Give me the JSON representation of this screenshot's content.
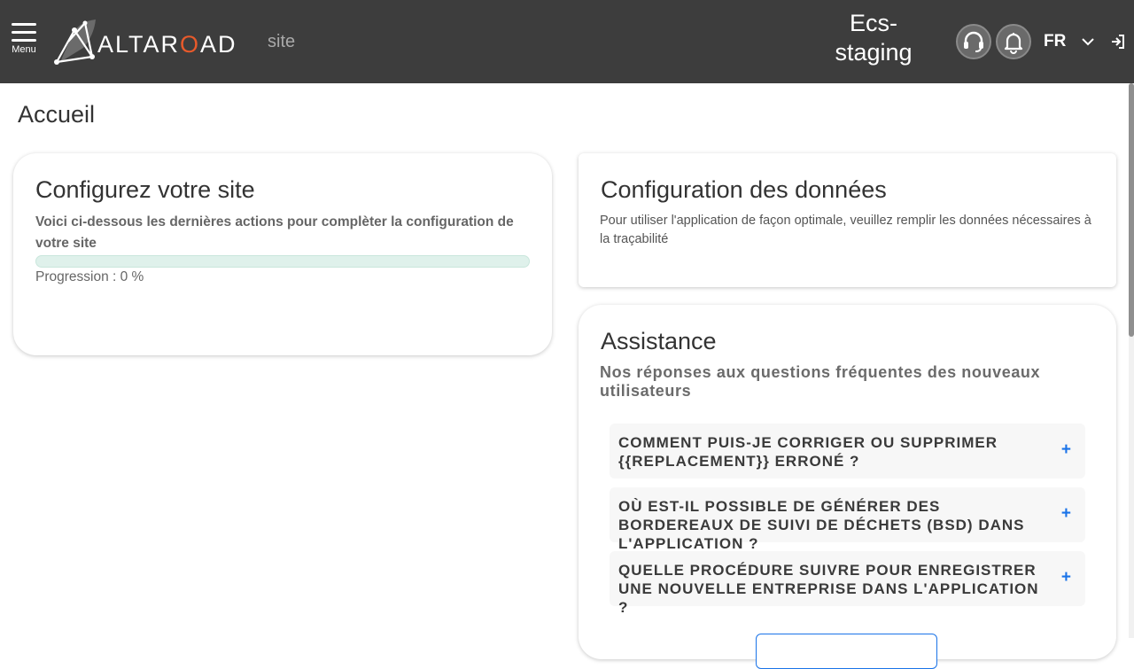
{
  "header": {
    "menu_label": "Menu",
    "logo_text_part1": "ALTAR",
    "logo_text_o": "O",
    "logo_text_part2": "AD",
    "site_label": "site",
    "environment": "Ecs-staging",
    "language": "FR",
    "icons": {
      "menu": "hamburger-icon",
      "support": "headset-icon",
      "notifications": "bell-icon",
      "language_dropdown": "chevron-down-icon",
      "login": "sign-in-icon"
    },
    "colors": {
      "bar": "#3d3d3d",
      "logo_accent": "#e85a2b"
    }
  },
  "page": {
    "title": "Accueil"
  },
  "config_card": {
    "title": "Configurez votre site",
    "subtitle": "Voici ci-dessous les dernières actions pour complèter la configuration de votre site",
    "progress_value": 0,
    "progress_text": "Progression : 0 %"
  },
  "data_card": {
    "title": "Configuration des données",
    "description": "Pour utiliser l'application de façon optimale, veuillez remplir les données nécessaires à la traçabilité"
  },
  "assist_card": {
    "title": "Assistance",
    "subtitle": "Nos réponses aux questions fréquentes des nouveaux utilisateurs",
    "faqs": [
      {
        "question": "Comment puis-je corriger ou supprimer {{REPLACEMENT}} erroné ?",
        "toggle": "+"
      },
      {
        "question": "Où est-il possible de générer des bordereaux de suivi de déchets (BSD) dans l'application ?",
        "toggle": "+"
      },
      {
        "question": "Quelle procédure suivre pour enregistrer une nouvelle entreprise dans l'application ?",
        "toggle": "+"
      }
    ],
    "accent_color": "#1a73e8"
  }
}
